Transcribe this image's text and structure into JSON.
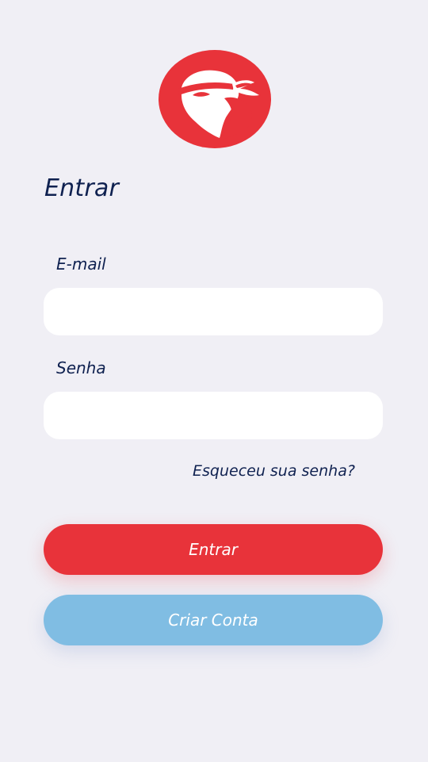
{
  "colors": {
    "background": "#f0eff5",
    "brand_red": "#e8333a",
    "primary_text": "#0f2150",
    "secondary_button": "#80bde3",
    "field_background": "#ffffff"
  },
  "logo": {
    "icon": "ninja-bird-logo-icon"
  },
  "title": "Entrar",
  "form": {
    "email_label": "E-mail",
    "email_value": "",
    "password_label": "Senha",
    "password_value": "",
    "forgot_password": "Esqueceu sua senha?"
  },
  "buttons": {
    "login": "Entrar",
    "create_account": "Criar Conta"
  }
}
